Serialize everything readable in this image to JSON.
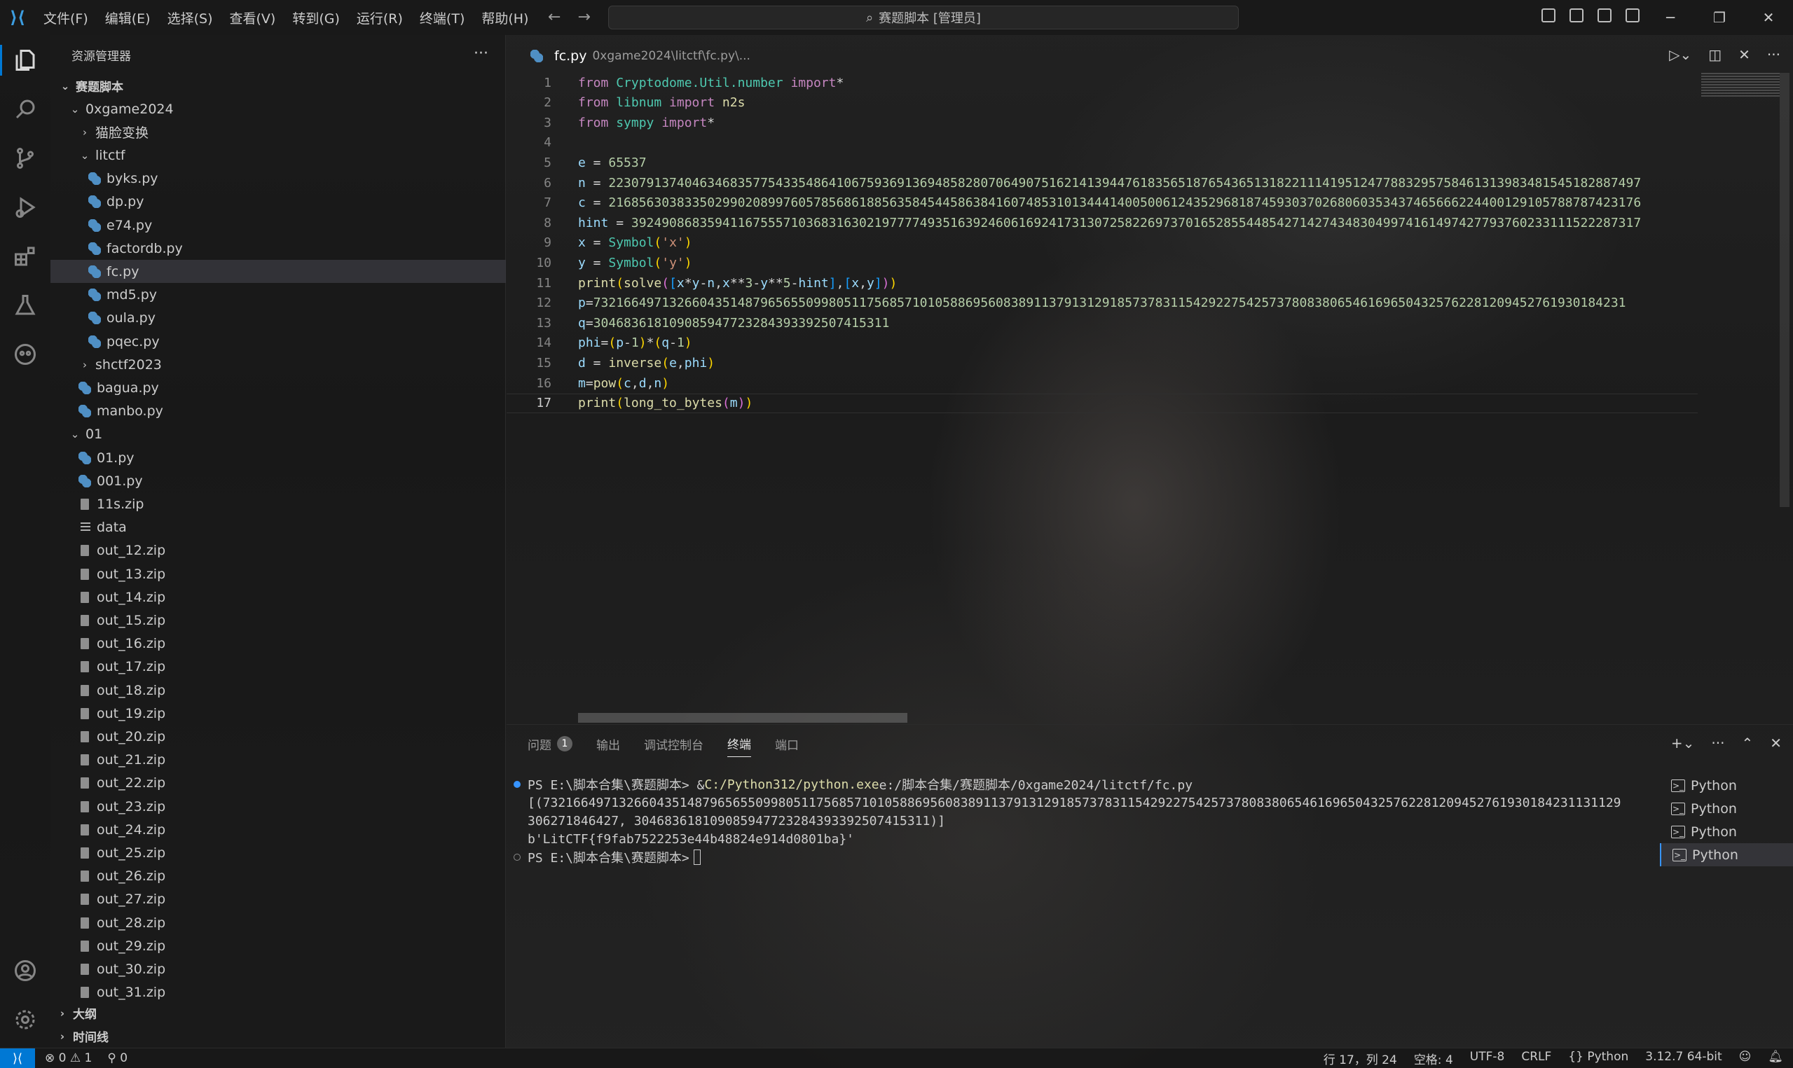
{
  "titlebar": {
    "menus": [
      "文件(F)",
      "编辑(E)",
      "选择(S)",
      "查看(V)",
      "转到(G)",
      "运行(R)",
      "终端(T)",
      "帮助(H)"
    ],
    "search": "赛题脚本 [管理员]"
  },
  "explorer": {
    "title": "资源管理器",
    "root": "赛题脚本",
    "items": [
      {
        "label": "0xgame2024",
        "type": "folder-open",
        "depth": 1
      },
      {
        "label": "猫脸变换",
        "type": "folder-closed",
        "depth": 2
      },
      {
        "label": "litctf",
        "type": "folder-open",
        "depth": 2
      },
      {
        "label": "byks.py",
        "type": "py",
        "depth": 3
      },
      {
        "label": "dp.py",
        "type": "py",
        "depth": 3
      },
      {
        "label": "e74.py",
        "type": "py",
        "depth": 3
      },
      {
        "label": "factordb.py",
        "type": "py",
        "depth": 3
      },
      {
        "label": "fc.py",
        "type": "py",
        "depth": 3,
        "selected": true
      },
      {
        "label": "md5.py",
        "type": "py",
        "depth": 3
      },
      {
        "label": "oula.py",
        "type": "py",
        "depth": 3
      },
      {
        "label": "pqec.py",
        "type": "py",
        "depth": 3
      },
      {
        "label": "shctf2023",
        "type": "folder-closed",
        "depth": 2
      },
      {
        "label": "bagua.py",
        "type": "py",
        "depth": 2
      },
      {
        "label": "manbo.py",
        "type": "py",
        "depth": 2
      },
      {
        "label": "01",
        "type": "folder-open",
        "depth": 1
      },
      {
        "label": "01.py",
        "type": "py",
        "depth": 2
      },
      {
        "label": "001.py",
        "type": "py",
        "depth": 2
      },
      {
        "label": "11s.zip",
        "type": "zip",
        "depth": 2
      },
      {
        "label": "data",
        "type": "data",
        "depth": 2
      },
      {
        "label": "out_12.zip",
        "type": "zip",
        "depth": 2
      },
      {
        "label": "out_13.zip",
        "type": "zip",
        "depth": 2
      },
      {
        "label": "out_14.zip",
        "type": "zip",
        "depth": 2
      },
      {
        "label": "out_15.zip",
        "type": "zip",
        "depth": 2
      },
      {
        "label": "out_16.zip",
        "type": "zip",
        "depth": 2
      },
      {
        "label": "out_17.zip",
        "type": "zip",
        "depth": 2
      },
      {
        "label": "out_18.zip",
        "type": "zip",
        "depth": 2
      },
      {
        "label": "out_19.zip",
        "type": "zip",
        "depth": 2
      },
      {
        "label": "out_20.zip",
        "type": "zip",
        "depth": 2
      },
      {
        "label": "out_21.zip",
        "type": "zip",
        "depth": 2
      },
      {
        "label": "out_22.zip",
        "type": "zip",
        "depth": 2
      },
      {
        "label": "out_23.zip",
        "type": "zip",
        "depth": 2
      },
      {
        "label": "out_24.zip",
        "type": "zip",
        "depth": 2
      },
      {
        "label": "out_25.zip",
        "type": "zip",
        "depth": 2
      },
      {
        "label": "out_26.zip",
        "type": "zip",
        "depth": 2
      },
      {
        "label": "out_27.zip",
        "type": "zip",
        "depth": 2
      },
      {
        "label": "out_28.zip",
        "type": "zip",
        "depth": 2
      },
      {
        "label": "out_29.zip",
        "type": "zip",
        "depth": 2
      },
      {
        "label": "out_30.zip",
        "type": "zip",
        "depth": 2
      },
      {
        "label": "out_31.zip",
        "type": "zip",
        "depth": 2
      }
    ],
    "sections": [
      "大纲",
      "时间线"
    ]
  },
  "editor": {
    "tab": "fc.py",
    "tab_path": "0xgame2024\\litctf\\fc.py\\...",
    "current_line": 17,
    "lines": [
      [
        [
          "from ",
          "kw"
        ],
        [
          "Cryptodome.Util.number ",
          "mod"
        ],
        [
          "import",
          "kw"
        ],
        [
          "*",
          "op"
        ]
      ],
      [
        [
          "from ",
          "kw"
        ],
        [
          "libnum ",
          "mod"
        ],
        [
          "import ",
          "kw"
        ],
        [
          "n2s",
          "fn"
        ]
      ],
      [
        [
          "from ",
          "kw"
        ],
        [
          "sympy ",
          "mod"
        ],
        [
          "import",
          "kw"
        ],
        [
          "*",
          "op"
        ]
      ],
      [],
      [
        [
          "e",
          "var"
        ],
        [
          " = ",
          "op"
        ],
        [
          "65537",
          "num"
        ]
      ],
      [
        [
          "n",
          "var"
        ],
        [
          " = ",
          "op"
        ],
        [
          "2230791374046346835775433548641067593691369485828070649075162141394476183565187654365131822111419512477883295758461313983481545182887497",
          "num"
        ]
      ],
      [
        [
          "c",
          "var"
        ],
        [
          " = ",
          "op"
        ],
        [
          "2168563038335029902089976057856861885635845445863841607485310134441400500612435296818745930370268060353437465666224400129105788787423176",
          "num"
        ]
      ],
      [
        [
          "hint",
          "var"
        ],
        [
          " = ",
          "op"
        ],
        [
          "3924908683594116755571036831630219777749351639246061692417313072582269737016528554485427142743483049974161497427793760233111522287317",
          "num"
        ]
      ],
      [
        [
          "x",
          "var"
        ],
        [
          " = ",
          "op"
        ],
        [
          "Symbol",
          "mod"
        ],
        [
          "(",
          "br1"
        ],
        [
          "'x'",
          "str"
        ],
        [
          ")",
          "br1"
        ]
      ],
      [
        [
          "y",
          "var"
        ],
        [
          " = ",
          "op"
        ],
        [
          "Symbol",
          "mod"
        ],
        [
          "(",
          "br1"
        ],
        [
          "'y'",
          "str"
        ],
        [
          ")",
          "br1"
        ]
      ],
      [
        [
          "print",
          "fn"
        ],
        [
          "(",
          "br1"
        ],
        [
          "solve",
          "fn"
        ],
        [
          "(",
          "br2"
        ],
        [
          "[",
          "br3"
        ],
        [
          "x",
          "var"
        ],
        [
          "*",
          "op"
        ],
        [
          "y",
          "var"
        ],
        [
          "-",
          "op"
        ],
        [
          "n",
          "var"
        ],
        [
          ",",
          "op"
        ],
        [
          "x",
          "var"
        ],
        [
          "**",
          "op"
        ],
        [
          "3",
          "num"
        ],
        [
          "-",
          "op"
        ],
        [
          "y",
          "var"
        ],
        [
          "**",
          "op"
        ],
        [
          "5",
          "num"
        ],
        [
          "-",
          "op"
        ],
        [
          "hint",
          "var"
        ],
        [
          "]",
          "br3"
        ],
        [
          ",",
          "op"
        ],
        [
          "[",
          "br3"
        ],
        [
          "x",
          "var"
        ],
        [
          ",",
          "op"
        ],
        [
          "y",
          "var"
        ],
        [
          "]",
          "br3"
        ],
        [
          ")",
          "br2"
        ],
        [
          ")",
          "br1"
        ]
      ],
      [
        [
          "p",
          "var"
        ],
        [
          "=",
          "op"
        ],
        [
          "7321664971326604351487965655099805117568571010588695608389113791312918573783115429227542573780838065461696504325762281209452761930184231",
          "num"
        ]
      ],
      [
        [
          "q",
          "var"
        ],
        [
          "=",
          "op"
        ],
        [
          "304683618109085947723284393392507415311",
          "num"
        ]
      ],
      [
        [
          "phi",
          "var"
        ],
        [
          "=",
          "op"
        ],
        [
          "(",
          "br1"
        ],
        [
          "p",
          "var"
        ],
        [
          "-",
          "op"
        ],
        [
          "1",
          "num"
        ],
        [
          ")",
          "br1"
        ],
        [
          "*",
          "op"
        ],
        [
          "(",
          "br1"
        ],
        [
          "q",
          "var"
        ],
        [
          "-",
          "op"
        ],
        [
          "1",
          "num"
        ],
        [
          ")",
          "br1"
        ]
      ],
      [
        [
          "d",
          "var"
        ],
        [
          " = ",
          "op"
        ],
        [
          "inverse",
          "fn"
        ],
        [
          "(",
          "br1"
        ],
        [
          "e",
          "var"
        ],
        [
          ",",
          "op"
        ],
        [
          "phi",
          "var"
        ],
        [
          ")",
          "br1"
        ]
      ],
      [
        [
          "m",
          "var"
        ],
        [
          "=",
          "op"
        ],
        [
          "pow",
          "fn"
        ],
        [
          "(",
          "br1"
        ],
        [
          "c",
          "var"
        ],
        [
          ",",
          "op"
        ],
        [
          "d",
          "var"
        ],
        [
          ",",
          "op"
        ],
        [
          "n",
          "var"
        ],
        [
          ")",
          "br1"
        ]
      ],
      [
        [
          "print",
          "fn"
        ],
        [
          "(",
          "br1"
        ],
        [
          "long_to_bytes",
          "fn"
        ],
        [
          "(",
          "br2"
        ],
        [
          "m",
          "var"
        ],
        [
          ")",
          "br2"
        ],
        [
          ")",
          "br1"
        ]
      ]
    ]
  },
  "panel": {
    "tabs": [
      "问题",
      "输出",
      "调试控制台",
      "终端",
      "端口"
    ],
    "problems_count": "1",
    "active_tab": "终端",
    "terminal": {
      "line1_prompt": "PS E:\\脚本合集\\赛题脚本> & ",
      "line1_exe": "C:/Python312/python.exe",
      "line1_arg": " e:/脚本合集/赛题脚本/0xgame2024/litctf/fc.py",
      "line2": "[(7321664971326604351487965655099805117568571010588695608389113791312918573783115429227542573780838065461696504325762281209452761930184231131129",
      "line3": "306271846427, 304683618109085947723284393392507415311)]",
      "line4": "b'LitCTF{f9fab7522253e44b48824e914d0801ba}'",
      "line5": "PS E:\\脚本合集\\赛题脚本> "
    },
    "terminal_list": [
      "Python",
      "Python",
      "Python",
      "Python"
    ]
  },
  "statusbar": {
    "errors": "0",
    "warnings": "1",
    "ports": "0",
    "position": "行 17，列 24",
    "spaces": "空格: 4",
    "encoding": "UTF-8",
    "eol": "CRLF",
    "language": "Python",
    "interpreter": "3.12.7 64-bit"
  }
}
